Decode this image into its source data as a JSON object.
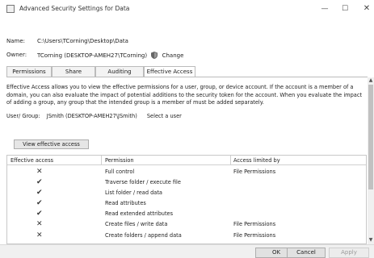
{
  "window": {
    "title": "Advanced Security Settings for Data",
    "minimize_glyph": "—",
    "maximize_glyph": "☐",
    "close_glyph": "✕"
  },
  "info": {
    "name_label": "Name:",
    "name_value": "C:\\Users\\TCorning\\Desktop\\Data",
    "owner_label": "Owner:",
    "owner_value": "TCorning (DESKTOP-AMEH27\\TCorning)",
    "change_label": "Change"
  },
  "tabs": [
    {
      "label": "Permissions"
    },
    {
      "label": "Share"
    },
    {
      "label": "Auditing"
    },
    {
      "label": "Effective Access"
    }
  ],
  "description": "Effective Access allows you to view the effective permissions for a user, group, or device account. If the account is a member of a domain, you can also evaluate the impact of potential additions to the security token for the account. When you evaluate the impact of adding a group, any group that the intended group is a member of must be added separately.",
  "user_group": {
    "label": "User/ Group:",
    "value": "JSmith (DESKTOP-AMEH27\\JSmith)",
    "select_label": "Select a user"
  },
  "view_button": "View effective access",
  "grid": {
    "columns": [
      "Effective access",
      "Permission",
      "Access limited by"
    ],
    "rows": [
      {
        "mark": "✕",
        "icon": "x-icon",
        "permission": "Full control",
        "limited_by": "File Permissions"
      },
      {
        "mark": "✔",
        "icon": "check-icon",
        "permission": "Traverse folder / execute file",
        "limited_by": ""
      },
      {
        "mark": "✔",
        "icon": "check-icon",
        "permission": "List folder / read data",
        "limited_by": ""
      },
      {
        "mark": "✔",
        "icon": "check-icon",
        "permission": "Read attributes",
        "limited_by": ""
      },
      {
        "mark": "✔",
        "icon": "check-icon",
        "permission": "Read extended attributes",
        "limited_by": ""
      },
      {
        "mark": "✕",
        "icon": "x-icon",
        "permission": "Create files / write data",
        "limited_by": "File Permissions"
      },
      {
        "mark": "✕",
        "icon": "x-icon",
        "permission": "Create folders / append data",
        "limited_by": "File Permissions"
      }
    ]
  },
  "footer": {
    "ok": "OK",
    "cancel": "Cancel",
    "apply": "Apply"
  }
}
